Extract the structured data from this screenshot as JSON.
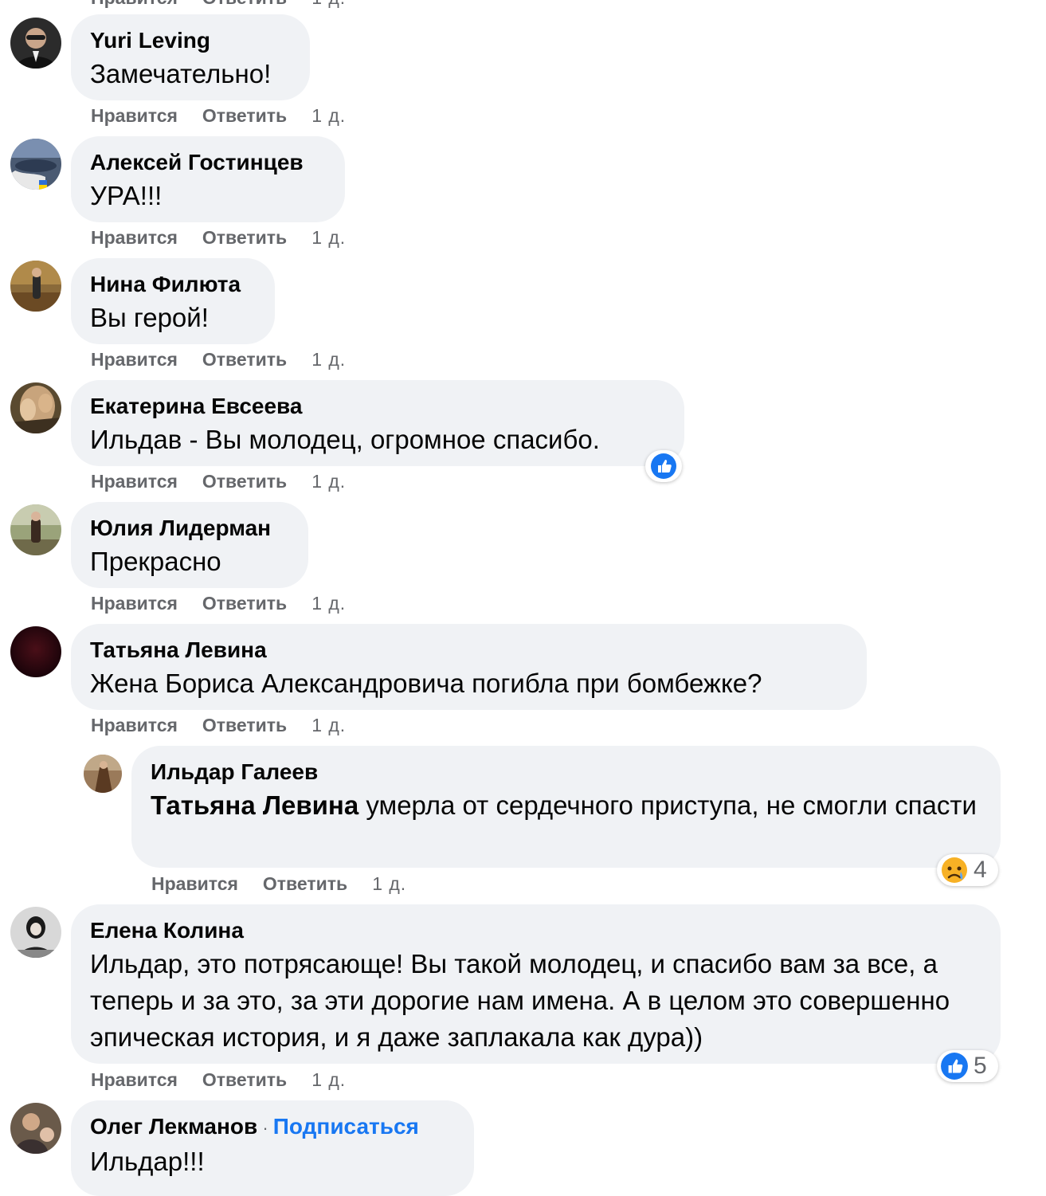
{
  "actions": {
    "like": "Нравится",
    "reply": "Ответить"
  },
  "comments": [
    {
      "name": "Yuri Leving",
      "text": "Замечательно!",
      "time": "1 д."
    },
    {
      "name": "Алексей Гостинцев",
      "text": "УРА!!!",
      "time": "1 д."
    },
    {
      "name": "Нина Филюта",
      "text": "Вы герой!",
      "time": "1 д."
    },
    {
      "name": "Екатерина Евсеева",
      "text": "Ильдав - Вы молодец, огромное спасибо.",
      "time": "1 д.",
      "reaction": "like-icon"
    },
    {
      "name": "Юлия Лидерман",
      "text": "Прекрасно",
      "time": "1 д."
    },
    {
      "name": "Татьяна Левина",
      "text": "Жена Бориса Александровича погибла при бомбежке?",
      "time": "1 д."
    },
    {
      "name": "Ильдар Галеев",
      "mention": "Татьяна Левина",
      "text": " умерла от сердечного приступа, не смогли спасти",
      "time": "1 д.",
      "reaction": "sad-icon",
      "reaction_count": "4"
    },
    {
      "name": "Елена Колина",
      "text": "Ильдар, это потрясающе! Вы такой молодец, и спасибо вам за все, а теперь и за это, за эти дорогие нам имена. А в целом это совершенно эпическая история, и я даже заплакала как дура))",
      "time": "1 д.",
      "reaction": "like-icon",
      "reaction_count": "5"
    },
    {
      "name": "Олег Лекманов",
      "separator": " · ",
      "follow": "Подписаться",
      "text": "Ильдар!!!"
    }
  ],
  "colors": {
    "bubble": "#f0f2f5",
    "secondary_text": "#65676b",
    "link": "#1877f2",
    "like": "#1877f2"
  }
}
